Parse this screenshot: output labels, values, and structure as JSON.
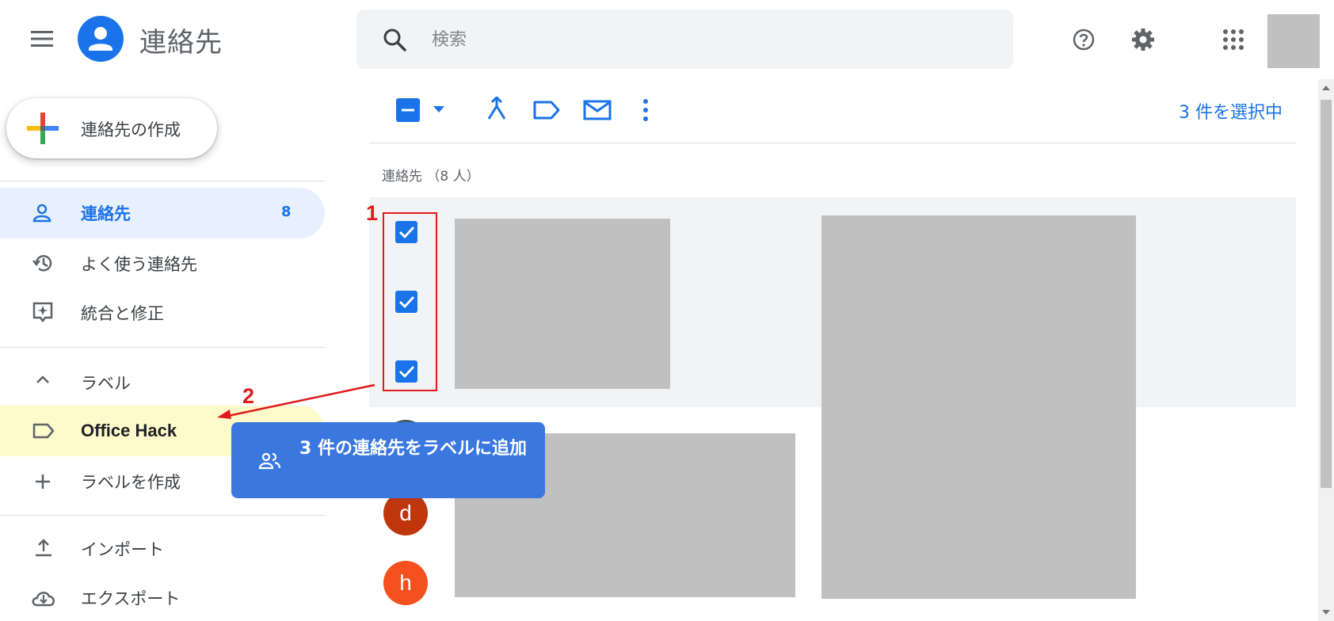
{
  "header": {
    "app_title": "連絡先",
    "search_placeholder": "検索"
  },
  "sidebar": {
    "create_label": "連絡先の作成",
    "items": [
      {
        "label": "連絡先",
        "count": "8"
      },
      {
        "label": "よく使う連絡先"
      },
      {
        "label": "統合と修正"
      }
    ],
    "labels_header": "ラベル",
    "label_items": [
      {
        "label": "Office Hack"
      },
      {
        "label": "ラベルを作成"
      }
    ],
    "bottom_items": [
      {
        "label": "インポート"
      },
      {
        "label": "エクスポート"
      }
    ]
  },
  "toolbar": {
    "selection_count": "3 件を選択中"
  },
  "main": {
    "section_header": "連絡先 （8 人）",
    "avatars": [
      {
        "letter": "d",
        "color": "#bf360c"
      },
      {
        "letter": "h",
        "color": "#f4511e"
      }
    ]
  },
  "tooltip": {
    "text": "3 件の連絡先をラベルに追加"
  },
  "annotations": {
    "step1": "1",
    "step2": "2"
  },
  "colors": {
    "accent": "#1a73e8",
    "annotation": "#e01b1b",
    "highlight": "#fdfbcb"
  }
}
